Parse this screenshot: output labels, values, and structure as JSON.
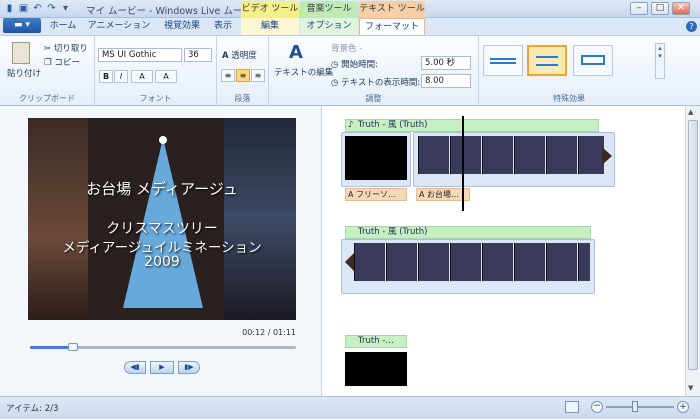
{
  "titlebar": {
    "title": "マイ ムービー - Windows Live ムービー ...",
    "context_video": "ビデオ ツール",
    "context_music": "音楽ツール",
    "context_text": "テキスト ツール",
    "minimize": "–",
    "maximize": "□",
    "close": "✕"
  },
  "tabs": {
    "home": "ホーム",
    "animation": "アニメーション",
    "visual_effects": "視覚効果",
    "view": "表示",
    "edit": "編集",
    "options": "オプション",
    "format": "フォーマット"
  },
  "ribbon": {
    "clipboard": {
      "paste": "貼り付け",
      "cut": "切り取り",
      "copy": "コピー",
      "label": "クリップボード"
    },
    "font": {
      "family": "MS UI Gothic",
      "size": "36",
      "bold": "B",
      "italic": "I",
      "color_btn": "A",
      "grow_btn": "A",
      "label": "フォント"
    },
    "paragraph": {
      "transparency": "透明度",
      "label": "段落"
    },
    "adjust": {
      "edit_text": "テキストの編集",
      "bg_color": "背景色 -",
      "start_time_label": "開始時間:",
      "start_time": "5.00 秒",
      "duration_label": "テキストの表示時間:",
      "duration": "8.00",
      "label": "調整"
    },
    "effects": {
      "label": "特殊効果"
    }
  },
  "preview": {
    "overlay_line1": "お台場 メディアージュ",
    "overlay_line2": "クリスマスツリー",
    "overlay_line3": "メディアージュイルミネーション",
    "overlay_line4": "2009",
    "time": "00:12 / 01:11",
    "seek_fraction": 0.16
  },
  "timeline": {
    "row1_caption": "Truth - 風 (Truth)",
    "row1_text1": "フリーソ…",
    "row1_text2": "お台場…",
    "row2_caption": "Truth - 風 (Truth)",
    "row3_caption": "Truth -…"
  },
  "status": {
    "items": "アイテム: 2/3"
  }
}
